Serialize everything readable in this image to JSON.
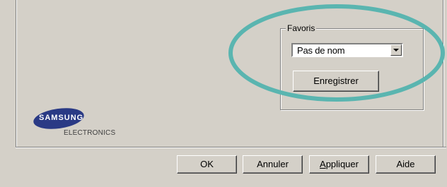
{
  "favorites": {
    "group_label": "Favoris",
    "selected_value": "Pas de nom",
    "save_label": "Enregistrer"
  },
  "logo": {
    "brand": "SAMSUNG",
    "sub": "ELECTRONICS"
  },
  "footer": {
    "ok_label": "OK",
    "cancel_label": "Annuler",
    "apply_label": "Appliquer",
    "help_label": "Aide"
  },
  "colors": {
    "dialog_bg": "#d4d0c8",
    "highlight_ring": "#5ab5b0",
    "logo_blue": "#2a3a85"
  },
  "icons": {
    "dropdown": "chevron-down-icon"
  }
}
